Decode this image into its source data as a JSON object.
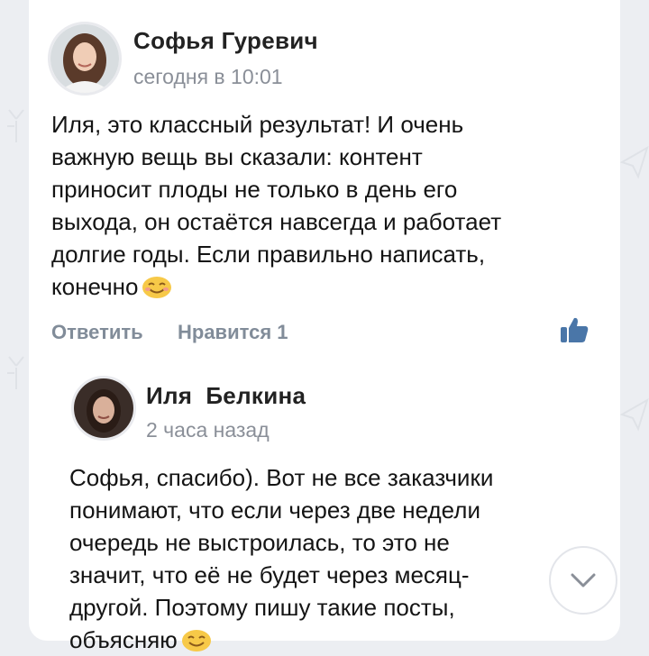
{
  "comment": {
    "author": "Софья Гуревич",
    "time": "сегодня в 10:01",
    "text_lines": [
      "Иля, это классный результат! И очень",
      "важную вещь вы сказали: контент",
      "приносит плоды не только в день его",
      "выхода, он остаётся навсегда и работает",
      "долгие годы. Если правильно написать,",
      "конечно"
    ],
    "reply_label": "Ответить",
    "likes_label": "Нравится 1",
    "like_icon": "thumbs-up-icon",
    "emoji": "smiling-face-icon"
  },
  "reply": {
    "author": "Иля  Белкина",
    "time": "2 часа назад",
    "text_lines": [
      "Софья, спасибо). Вот не все заказчики",
      "понимают, что если через две недели",
      "очередь не выстроилась, то это не",
      "значит, что её не будет через месяц-",
      "другой. Поэтому пишу такие посты,",
      "объясняю"
    ],
    "emoji": "smiling-face-icon"
  },
  "scroll_button_icon": "chevron-down-icon",
  "colors": {
    "accent": "#4a76a8",
    "background": "#eceef2",
    "card": "#ffffff",
    "muted_text": "#818c99",
    "emoji_yellow": "#f7c948"
  }
}
